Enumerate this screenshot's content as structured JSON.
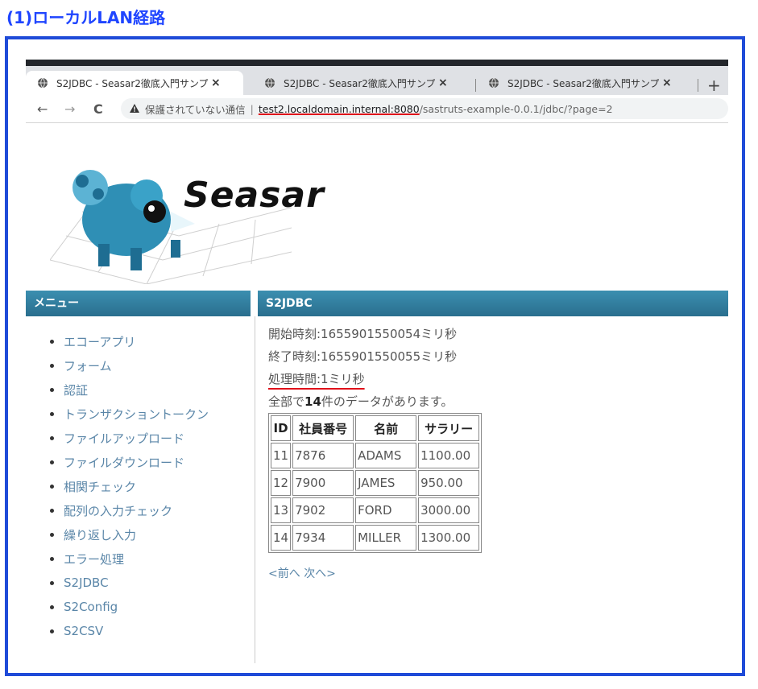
{
  "heading": "(1)ローカルLAN経路",
  "browser": {
    "tabs": [
      {
        "title": "S2JDBC - Seasar2徹底入門サンプル",
        "close": "×"
      },
      {
        "title": "S2JDBC - Seasar2徹底入門サンプル",
        "close": "×"
      },
      {
        "title": "S2JDBC - Seasar2徹底入門サンプル",
        "close": "×"
      }
    ],
    "new_tab": "+",
    "nav": {
      "back": "←",
      "forward": "→",
      "reload": "C"
    },
    "address": {
      "insecure_label": "保護されていない通信",
      "separator": "|",
      "host": "test2.localdomain.internal:8080",
      "path": "/sastruts-example-0.0.1/jdbc/?page=2"
    }
  },
  "logo": {
    "text": "Seasar"
  },
  "sidebar": {
    "title": "メニュー",
    "items": [
      "エコーアプリ",
      "フォーム",
      "認証",
      "トランザクショントークン",
      "ファイルアップロード",
      "ファイルダウンロード",
      "相関チェック",
      "配列の入力チェック",
      "繰り返し入力",
      "エラー処理",
      "S2JDBC",
      "S2Config",
      "S2CSV"
    ]
  },
  "main": {
    "title": "S2JDBC",
    "start_time": "開始時刻:1655901550054ミリ秒",
    "end_time": "終了時刻:1655901550055ミリ秒",
    "elapsed": "処理時間:1ミリ秒",
    "count_prefix": "全部で",
    "count_value": "14",
    "count_suffix": "件のデータがあります。",
    "table": {
      "headers": [
        "ID",
        "社員番号",
        "名前",
        "サラリー"
      ],
      "rows": [
        [
          "11",
          "7876",
          "ADAMS",
          "1100.00"
        ],
        [
          "12",
          "7900",
          "JAMES",
          "950.00"
        ],
        [
          "13",
          "7902",
          "FORD",
          "3000.00"
        ],
        [
          "14",
          "7934",
          "MILLER",
          "1300.00"
        ]
      ]
    },
    "pager": {
      "prev": "<前へ",
      "next": "次へ>"
    }
  }
}
